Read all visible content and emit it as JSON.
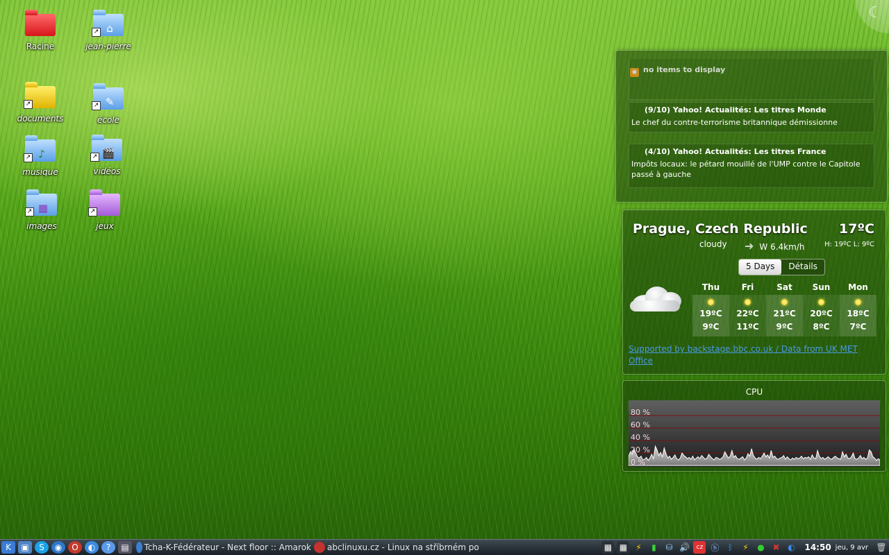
{
  "desktop": {
    "icons": [
      {
        "label": "Racine"
      },
      {
        "label": "jean-pierre"
      },
      {
        "label": "documents"
      },
      {
        "label": "école"
      },
      {
        "label": "musique"
      },
      {
        "label": "vidéos"
      },
      {
        "label": "images"
      },
      {
        "label": "jeux"
      }
    ]
  },
  "rss": {
    "empty_label": "no items to display",
    "items": [
      {
        "title": "(9/10) Yahoo! Actualités: Les titres Monde",
        "text": "Le chef du contre-terrorisme britannique démissionne"
      },
      {
        "title": "(4/10) Yahoo! Actualités: Les titres France",
        "text": "Impôts locaux: le pétard mouillé de l'UMP contre le Capitole passé à gauche"
      }
    ]
  },
  "weather": {
    "city": "Prague, Czech Republic",
    "temp": "17ºC",
    "condition": "cloudy",
    "wind": "W 6.4km/h",
    "high_low": "H: 19ºC L: 9ºC",
    "tabs": [
      "5 Days",
      "Détails"
    ],
    "active_tab": "5 Days",
    "forecast": [
      {
        "day": "Thu",
        "hi": "19ºC",
        "lo": "9ºC"
      },
      {
        "day": "Fri",
        "hi": "22ºC",
        "lo": "11ºC"
      },
      {
        "day": "Sat",
        "hi": "21ºC",
        "lo": "9ºC"
      },
      {
        "day": "Sun",
        "hi": "20ºC",
        "lo": "8ºC"
      },
      {
        "day": "Mon",
        "hi": "18ºC",
        "lo": "7ºC"
      }
    ],
    "credit": "Supported by backstage.bbc.co.uk / Data from UK MET Office"
  },
  "cpu": {
    "title": "CPU",
    "y_labels": [
      "80 %",
      "60 %",
      "40 %",
      "20 %",
      "0 %"
    ],
    "y_max": 100,
    "series": [
      14,
      22,
      18,
      27,
      20,
      14,
      12,
      15,
      9,
      10,
      13,
      8,
      12,
      18,
      11,
      31,
      25,
      16,
      21,
      14,
      28,
      19,
      12,
      15,
      10,
      13,
      17,
      11,
      9,
      12,
      20,
      16,
      14,
      11,
      13,
      10,
      15,
      9,
      12,
      14,
      11,
      16,
      13,
      10,
      12,
      18,
      14,
      11,
      9,
      13,
      12,
      10,
      11,
      14,
      22,
      17,
      12,
      15,
      24,
      13,
      16,
      11,
      10,
      12,
      14,
      9,
      12,
      19,
      15,
      27,
      16,
      12,
      10,
      13,
      11,
      15,
      20,
      14,
      17,
      12,
      24,
      13,
      15,
      11,
      10,
      12,
      13,
      16,
      10,
      14,
      11,
      9,
      12,
      10,
      13,
      11,
      12,
      15,
      11,
      13,
      12,
      14,
      10,
      17,
      12,
      11,
      24,
      15,
      11,
      13,
      10,
      12,
      14,
      11,
      10,
      13,
      15,
      12,
      11,
      10,
      22,
      14,
      18,
      12,
      11,
      14,
      20,
      11,
      10,
      12,
      16,
      11,
      13,
      10,
      12,
      25,
      22,
      14,
      12,
      8,
      11,
      9
    ],
    "color": "#ffffff"
  },
  "taskbar": {
    "tasks": [
      {
        "label": "Tcha-K-Fédérateur - Next floor :: Amarok"
      },
      {
        "label": "abclinuxu.cz - Linux na stříbrném po"
      }
    ],
    "clock": "14:50",
    "date": "jeu, 9 avr"
  },
  "colors": {
    "link": "#4a9ae6",
    "rss": "#f39c1d",
    "panel_border": "#c8f0a0"
  }
}
